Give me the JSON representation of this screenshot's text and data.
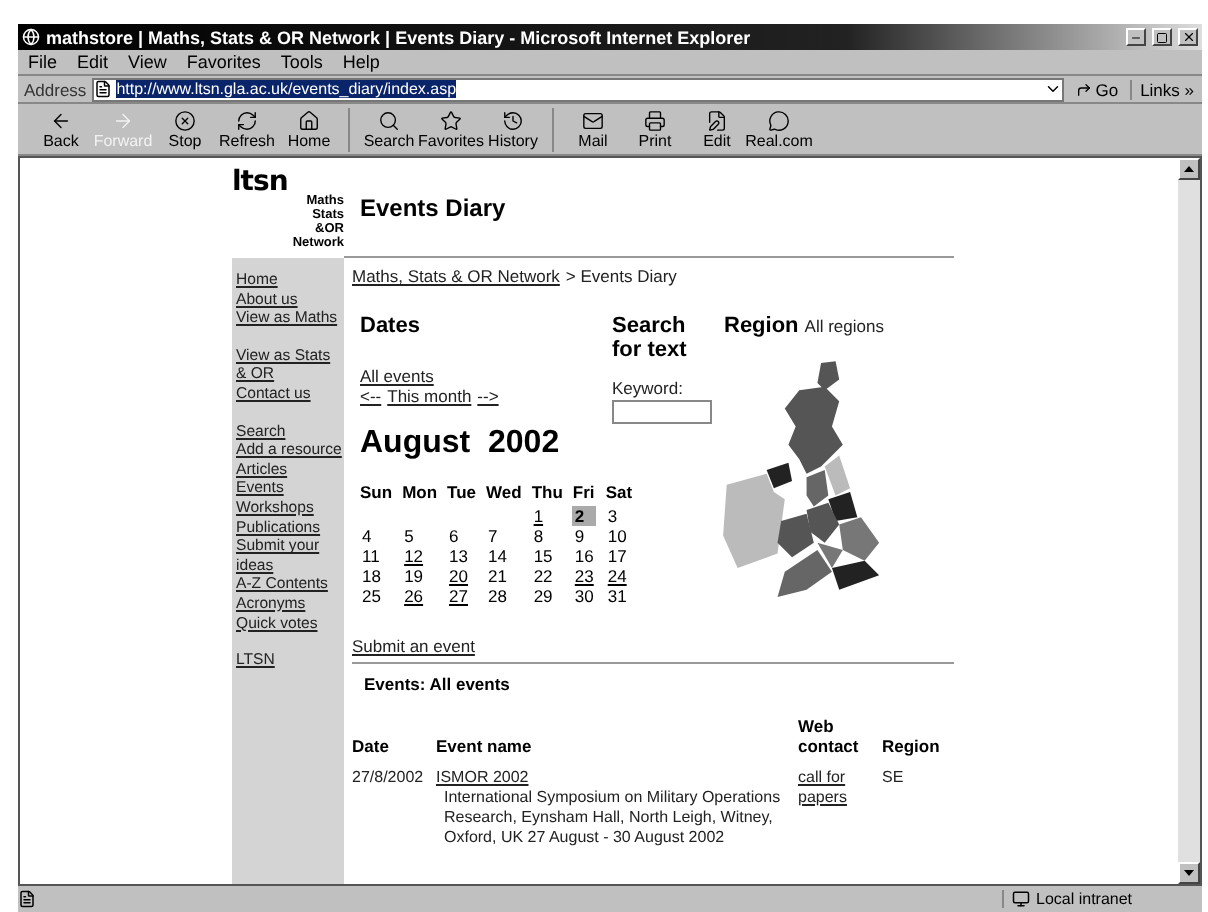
{
  "window": {
    "title": "mathstore | Maths, Stats & OR Network | Events Diary - Microsoft Internet Explorer"
  },
  "menu": [
    "File",
    "Edit",
    "View",
    "Favorites",
    "Tools",
    "Help"
  ],
  "address": {
    "label": "Address",
    "url": "http://www.ltsn.gla.ac.uk/events_diary/index.asp",
    "go": "Go",
    "links": "Links »"
  },
  "toolbar": [
    {
      "kind": "back",
      "label": "Back",
      "disabled": false
    },
    {
      "kind": "forward",
      "label": "Forward",
      "disabled": true
    },
    {
      "kind": "stop",
      "label": "Stop",
      "disabled": false
    },
    {
      "kind": "refresh",
      "label": "Refresh",
      "disabled": false
    },
    {
      "kind": "home",
      "label": "Home",
      "disabled": false
    },
    {
      "kind": "search",
      "label": "Search",
      "disabled": false
    },
    {
      "kind": "favorites",
      "label": "Favorites",
      "disabled": false
    },
    {
      "kind": "history",
      "label": "History",
      "disabled": false
    },
    {
      "kind": "mail",
      "label": "Mail",
      "disabled": false
    },
    {
      "kind": "print",
      "label": "Print",
      "disabled": false
    },
    {
      "kind": "edit",
      "label": "Edit",
      "disabled": false
    },
    {
      "kind": "real",
      "label": "Real.com",
      "disabled": false
    }
  ],
  "logo": {
    "mark": "ltsn",
    "lines": [
      "Maths",
      "Stats",
      "&OR",
      "Network"
    ]
  },
  "page_title": "Events Diary",
  "sidebar": {
    "groups": [
      [
        "Home",
        "About us",
        "View as Maths"
      ],
      [
        "View as Stats & OR",
        "Contact us"
      ],
      [
        "Search",
        "Add a resource",
        "Articles",
        "Events",
        "Workshops",
        "Publications",
        "Submit your ideas",
        "A-Z Contents",
        "Acronyms",
        "Quick votes"
      ],
      [
        "LTSN"
      ]
    ]
  },
  "breadcrumb": {
    "link": "Maths, Stats & OR Network",
    "rest": "> Events Diary"
  },
  "dates": {
    "heading": "Dates",
    "all_events": "All events",
    "nav": [
      "<--",
      "This month",
      "-->"
    ],
    "month": "August  2002",
    "weekdays": [
      "Sun",
      "Mon",
      "Tue",
      "Wed",
      "Thu",
      "Fri",
      "Sat"
    ],
    "weeks": [
      [
        {
          "kind": "blank"
        },
        {
          "kind": "blank"
        },
        {
          "kind": "blank"
        },
        {
          "kind": "blank"
        },
        {
          "day": "1",
          "link": true,
          "selected": false
        },
        {
          "day": "2",
          "link": false,
          "selected": true
        },
        {
          "day": "3",
          "link": false,
          "selected": false
        }
      ],
      [
        {
          "day": "4",
          "link": false,
          "selected": false
        },
        {
          "day": "5",
          "link": false,
          "selected": false
        },
        {
          "day": "6",
          "link": false,
          "selected": false
        },
        {
          "day": "7",
          "link": false,
          "selected": false
        },
        {
          "day": "8",
          "link": false,
          "selected": false
        },
        {
          "day": "9",
          "link": false,
          "selected": false
        },
        {
          "day": "10",
          "link": false,
          "selected": false
        }
      ],
      [
        {
          "day": "11",
          "link": false,
          "selected": false
        },
        {
          "day": "12",
          "link": true,
          "selected": false
        },
        {
          "day": "13",
          "link": false,
          "selected": false
        },
        {
          "day": "14",
          "link": false,
          "selected": false
        },
        {
          "day": "15",
          "link": false,
          "selected": false
        },
        {
          "day": "16",
          "link": false,
          "selected": false
        },
        {
          "day": "17",
          "link": false,
          "selected": false
        }
      ],
      [
        {
          "day": "18",
          "link": false,
          "selected": false
        },
        {
          "day": "19",
          "link": false,
          "selected": false
        },
        {
          "day": "20",
          "link": true,
          "selected": false
        },
        {
          "day": "21",
          "link": false,
          "selected": false
        },
        {
          "day": "22",
          "link": false,
          "selected": false
        },
        {
          "day": "23",
          "link": true,
          "selected": false
        },
        {
          "day": "24",
          "link": true,
          "selected": false
        }
      ],
      [
        {
          "day": "25",
          "link": false,
          "selected": false
        },
        {
          "day": "26",
          "link": true,
          "selected": false
        },
        {
          "day": "27",
          "link": true,
          "selected": false
        },
        {
          "day": "28",
          "link": false,
          "selected": false
        },
        {
          "day": "29",
          "link": false,
          "selected": false
        },
        {
          "day": "30",
          "link": false,
          "selected": false
        },
        {
          "day": "31",
          "link": false,
          "selected": false
        }
      ]
    ]
  },
  "search": {
    "heading": "Search for text",
    "label": "Keyword:"
  },
  "region": {
    "heading": "Region",
    "value": "All regions"
  },
  "submit_link": "Submit an event",
  "events": {
    "heading": "Events: All events",
    "columns": [
      "Date",
      "Event name",
      "Web contact",
      "Region"
    ],
    "rows": [
      {
        "date": "27/8/2002",
        "name": "ISMOR 2002",
        "description": "International Symposium on Military Operations Research, Eynsham Hall, North Leigh, Witney, Oxford, UK 27 August - 30 August 2002",
        "contact": "call for papers",
        "region": "SE"
      }
    ]
  },
  "status_bar": {
    "zone": "Local intranet"
  }
}
